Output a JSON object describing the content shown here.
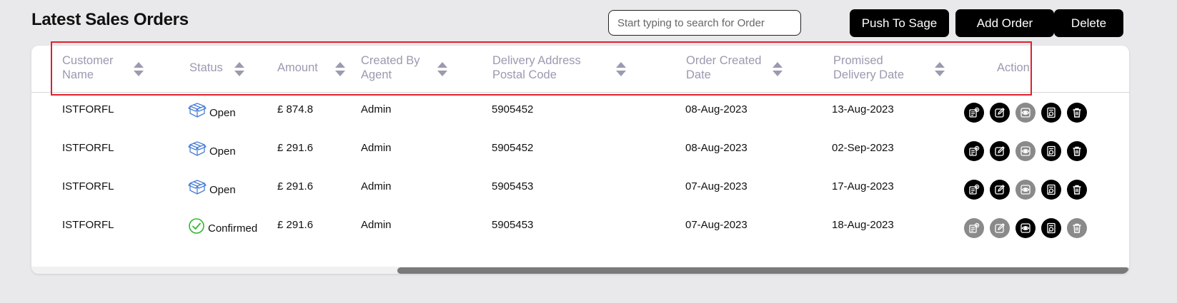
{
  "page_title": "Latest Sales Orders",
  "search": {
    "placeholder": "Start typing to search for Order"
  },
  "toolbar": {
    "push_label": "Push To Sage",
    "add_label": "Add Order",
    "delete_label": "Delete"
  },
  "columns": [
    {
      "l1": "Customer",
      "l2": "Name",
      "sortable": true
    },
    {
      "l1": "Status",
      "l2": "",
      "sortable": true
    },
    {
      "l1": "Amount",
      "l2": "",
      "sortable": true
    },
    {
      "l1": "Created By",
      "l2": "Agent",
      "sortable": true
    },
    {
      "l1": "Delivery Address",
      "l2": "Postal Code",
      "sortable": true
    },
    {
      "l1": "Order Created",
      "l2": "Date",
      "sortable": true
    },
    {
      "l1": "Promised",
      "l2": "Delivery Date",
      "sortable": true
    },
    {
      "l1": "Action",
      "l2": "",
      "sortable": false
    }
  ],
  "rows": [
    {
      "customer": "ISTFORFL",
      "status": "Open",
      "status_icon": "open-box-icon",
      "amount": "£ 874.8",
      "agent": "Admin",
      "postal": "5905452",
      "created": "08-Aug-2023",
      "promised": "13-Aug-2023",
      "actions_enabled": [
        true,
        true,
        false,
        true,
        true
      ]
    },
    {
      "customer": "ISTFORFL",
      "status": "Open",
      "status_icon": "open-box-icon",
      "amount": "£ 291.6",
      "agent": "Admin",
      "postal": "5905452",
      "created": "08-Aug-2023",
      "promised": "02-Sep-2023",
      "actions_enabled": [
        true,
        true,
        false,
        true,
        true
      ]
    },
    {
      "customer": "ISTFORFL",
      "status": "Open",
      "status_icon": "open-box-icon",
      "amount": "£ 291.6",
      "agent": "Admin",
      "postal": "5905453",
      "created": "07-Aug-2023",
      "promised": "17-Aug-2023",
      "actions_enabled": [
        true,
        true,
        false,
        true,
        true
      ]
    },
    {
      "customer": "ISTFORFL",
      "status": "Confirmed",
      "status_icon": "check-circle-icon",
      "amount": "£ 291.6",
      "agent": "Admin",
      "postal": "5905453",
      "created": "07-Aug-2023",
      "promised": "18-Aug-2023",
      "actions_enabled": [
        false,
        false,
        true,
        true,
        false
      ]
    }
  ],
  "action_icons": [
    "invoice-icon",
    "edit-icon",
    "view-icon",
    "document-icon",
    "trash-icon"
  ],
  "colors": {
    "accent": "#000000",
    "disabled": "#8a8a8a",
    "header_text": "#9a9ab0",
    "confirmed_green": "#2eb82e",
    "open_blue": "#4a7fd6",
    "highlight": "#e0202e"
  }
}
